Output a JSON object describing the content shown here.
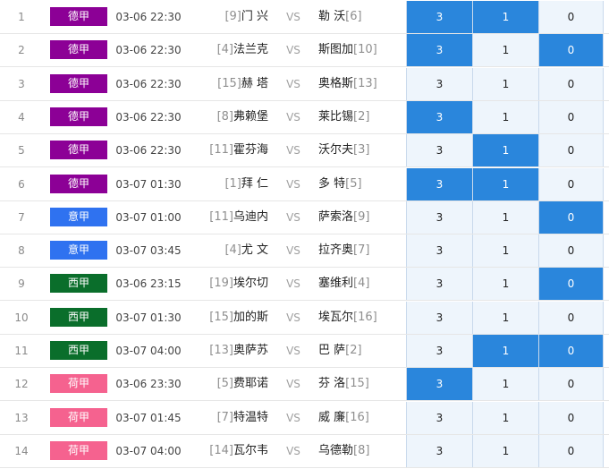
{
  "league_colors": {
    "德甲": "#8c0096",
    "意甲": "#2f72f0",
    "西甲": "#0a6e2b",
    "荷甲": "#f5628f"
  },
  "selection_color": "#2a86dc",
  "odds_bg_color": "#eef5fc",
  "matches": [
    {
      "idx": "1",
      "league": "德甲",
      "time": "03-06 22:30",
      "home_rank": "[9]",
      "home": "门 兴",
      "vs": "VS",
      "away": "勒 沃",
      "away_rank": "[6]",
      "odds": [
        "3",
        "1",
        "0"
      ],
      "selected": [
        true,
        true,
        false
      ]
    },
    {
      "idx": "2",
      "league": "德甲",
      "time": "03-06 22:30",
      "home_rank": "[4]",
      "home": "法兰克",
      "vs": "VS",
      "away": "斯图加",
      "away_rank": "[10]",
      "odds": [
        "3",
        "1",
        "0"
      ],
      "selected": [
        true,
        false,
        true
      ]
    },
    {
      "idx": "3",
      "league": "德甲",
      "time": "03-06 22:30",
      "home_rank": "[15]",
      "home": "赫 塔",
      "vs": "VS",
      "away": "奥格斯",
      "away_rank": "[13]",
      "odds": [
        "3",
        "1",
        "0"
      ],
      "selected": [
        false,
        false,
        false
      ]
    },
    {
      "idx": "4",
      "league": "德甲",
      "time": "03-06 22:30",
      "home_rank": "[8]",
      "home": "弗赖堡",
      "vs": "VS",
      "away": "莱比锡",
      "away_rank": "[2]",
      "odds": [
        "3",
        "1",
        "0"
      ],
      "selected": [
        true,
        false,
        false
      ]
    },
    {
      "idx": "5",
      "league": "德甲",
      "time": "03-06 22:30",
      "home_rank": "[11]",
      "home": "霍芬海",
      "vs": "VS",
      "away": "沃尔夫",
      "away_rank": "[3]",
      "odds": [
        "3",
        "1",
        "0"
      ],
      "selected": [
        false,
        true,
        false
      ]
    },
    {
      "idx": "6",
      "league": "德甲",
      "time": "03-07 01:30",
      "home_rank": "[1]",
      "home": "拜 仁",
      "vs": "VS",
      "away": "多 特",
      "away_rank": "[5]",
      "odds": [
        "3",
        "1",
        "0"
      ],
      "selected": [
        true,
        true,
        false
      ]
    },
    {
      "idx": "7",
      "league": "意甲",
      "time": "03-07 01:00",
      "home_rank": "[11]",
      "home": "乌迪内",
      "vs": "VS",
      "away": "萨索洛",
      "away_rank": "[9]",
      "odds": [
        "3",
        "1",
        "0"
      ],
      "selected": [
        false,
        false,
        true
      ]
    },
    {
      "idx": "8",
      "league": "意甲",
      "time": "03-07 03:45",
      "home_rank": "[4]",
      "home": "尤 文",
      "vs": "VS",
      "away": "拉齐奥",
      "away_rank": "[7]",
      "odds": [
        "3",
        "1",
        "0"
      ],
      "selected": [
        false,
        false,
        false
      ]
    },
    {
      "idx": "9",
      "league": "西甲",
      "time": "03-06 23:15",
      "home_rank": "[19]",
      "home": "埃尔切",
      "vs": "VS",
      "away": "塞维利",
      "away_rank": "[4]",
      "odds": [
        "3",
        "1",
        "0"
      ],
      "selected": [
        false,
        false,
        true
      ]
    },
    {
      "idx": "10",
      "league": "西甲",
      "time": "03-07 01:30",
      "home_rank": "[15]",
      "home": "加的斯",
      "vs": "VS",
      "away": "埃瓦尔",
      "away_rank": "[16]",
      "odds": [
        "3",
        "1",
        "0"
      ],
      "selected": [
        false,
        false,
        false
      ]
    },
    {
      "idx": "11",
      "league": "西甲",
      "time": "03-07 04:00",
      "home_rank": "[13]",
      "home": "奥萨苏",
      "vs": "VS",
      "away": "巴 萨",
      "away_rank": "[2]",
      "odds": [
        "3",
        "1",
        "0"
      ],
      "selected": [
        false,
        true,
        true
      ]
    },
    {
      "idx": "12",
      "league": "荷甲",
      "time": "03-06 23:30",
      "home_rank": "[5]",
      "home": "费耶诺",
      "vs": "VS",
      "away": "芬 洛",
      "away_rank": "[15]",
      "odds": [
        "3",
        "1",
        "0"
      ],
      "selected": [
        true,
        false,
        false
      ]
    },
    {
      "idx": "13",
      "league": "荷甲",
      "time": "03-07 01:45",
      "home_rank": "[7]",
      "home": "特温特",
      "vs": "VS",
      "away": "威 廉",
      "away_rank": "[16]",
      "odds": [
        "3",
        "1",
        "0"
      ],
      "selected": [
        false,
        false,
        false
      ]
    },
    {
      "idx": "14",
      "league": "荷甲",
      "time": "03-07 04:00",
      "home_rank": "[14]",
      "home": "瓦尔韦",
      "vs": "VS",
      "away": "乌德勒",
      "away_rank": "[8]",
      "odds": [
        "3",
        "1",
        "0"
      ],
      "selected": [
        false,
        false,
        false
      ]
    }
  ]
}
